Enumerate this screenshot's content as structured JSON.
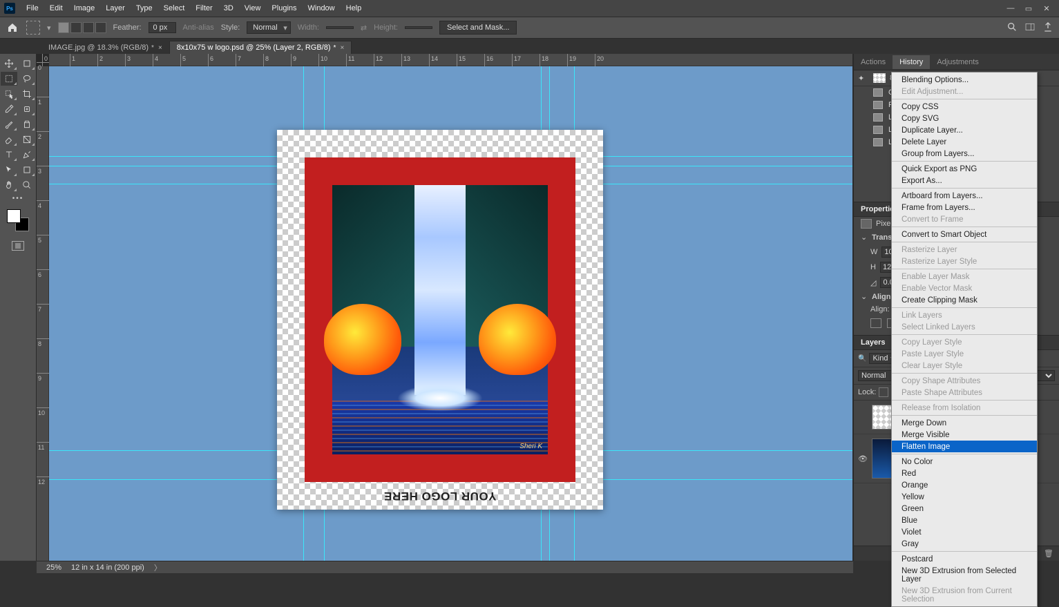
{
  "menubar": [
    "File",
    "Edit",
    "Image",
    "Layer",
    "Type",
    "Select",
    "Filter",
    "3D",
    "View",
    "Plugins",
    "Window",
    "Help"
  ],
  "optionsbar": {
    "feather_label": "Feather:",
    "feather_value": "0 px",
    "antialias": "Anti-alias",
    "style_label": "Style:",
    "style_value": "Normal",
    "width_label": "Width:",
    "height_label": "Height:",
    "select_mask": "Select and Mask..."
  },
  "tabs": [
    {
      "label": "IMAGE.jpg @ 18.3% (RGB/8)",
      "dirty": "*",
      "active": false
    },
    {
      "label": "8x10x75 w logo.psd @ 25% (Layer 2, RGB/8)",
      "dirty": "*",
      "active": true
    }
  ],
  "ruler_h": [
    "0",
    "1",
    "2",
    "3",
    "4",
    "5",
    "6",
    "7",
    "8",
    "9",
    "10",
    "11",
    "12",
    "13",
    "14",
    "15",
    "16",
    "17",
    "18",
    "19",
    "20"
  ],
  "ruler_v": [
    "0",
    "1",
    "2",
    "3",
    "4",
    "5",
    "6",
    "7",
    "8",
    "9",
    "10",
    "11",
    "12"
  ],
  "canvas": {
    "logo_text": "YOUR LOGO HERE",
    "signature": "Sheri K"
  },
  "panel_tabs_top": [
    "Actions",
    "History",
    "Adjustments"
  ],
  "history": {
    "doc": "8x10x75 w logo.psd",
    "items": [
      "Open",
      "Paste",
      "Layer V",
      "Layer V",
      "Layer V"
    ]
  },
  "properties": {
    "title": "Properties",
    "type": "Pixel Layer",
    "transform_title": "Transform",
    "w_label": "W",
    "w_val": "10 in",
    "h_label": "H",
    "h_val": "12 in",
    "angle": "0.00°",
    "align_title": "Align and Dis",
    "align_label": "Align:"
  },
  "layers": {
    "title": "Layers",
    "kind": "Kind",
    "blend": "Normal",
    "lock": "Lock:"
  },
  "context_menu": [
    {
      "t": "Blending Options..."
    },
    {
      "t": "Edit Adjustment...",
      "d": true
    },
    {
      "sep": true
    },
    {
      "t": "Copy CSS"
    },
    {
      "t": "Copy SVG"
    },
    {
      "t": "Duplicate Layer..."
    },
    {
      "t": "Delete Layer"
    },
    {
      "t": "Group from Layers..."
    },
    {
      "sep": true
    },
    {
      "t": "Quick Export as PNG"
    },
    {
      "t": "Export As..."
    },
    {
      "sep": true
    },
    {
      "t": "Artboard from Layers..."
    },
    {
      "t": "Frame from Layers..."
    },
    {
      "t": "Convert to Frame",
      "d": true
    },
    {
      "sep": true
    },
    {
      "t": "Convert to Smart Object"
    },
    {
      "sep": true
    },
    {
      "t": "Rasterize Layer",
      "d": true
    },
    {
      "t": "Rasterize Layer Style",
      "d": true
    },
    {
      "sep": true
    },
    {
      "t": "Enable Layer Mask",
      "d": true
    },
    {
      "t": "Enable Vector Mask",
      "d": true
    },
    {
      "t": "Create Clipping Mask"
    },
    {
      "sep": true
    },
    {
      "t": "Link Layers",
      "d": true
    },
    {
      "t": "Select Linked Layers",
      "d": true
    },
    {
      "sep": true
    },
    {
      "t": "Copy Layer Style",
      "d": true
    },
    {
      "t": "Paste Layer Style",
      "d": true
    },
    {
      "t": "Clear Layer Style",
      "d": true
    },
    {
      "sep": true
    },
    {
      "t": "Copy Shape Attributes",
      "d": true
    },
    {
      "t": "Paste Shape Attributes",
      "d": true
    },
    {
      "sep": true
    },
    {
      "t": "Release from Isolation",
      "d": true
    },
    {
      "sep": true
    },
    {
      "t": "Merge Down"
    },
    {
      "t": "Merge Visible"
    },
    {
      "t": "Flatten Image",
      "hl": true
    },
    {
      "sep": true
    },
    {
      "t": "No Color"
    },
    {
      "t": "Red"
    },
    {
      "t": "Orange"
    },
    {
      "t": "Yellow"
    },
    {
      "t": "Green"
    },
    {
      "t": "Blue"
    },
    {
      "t": "Violet"
    },
    {
      "t": "Gray"
    },
    {
      "sep": true
    },
    {
      "t": "Postcard"
    },
    {
      "t": "New 3D Extrusion from Selected Layer"
    },
    {
      "t": "New 3D Extrusion from Current Selection",
      "d": true
    }
  ],
  "statusbar": {
    "zoom": "25%",
    "docinfo": "12 in x 14 in (200 ppi)"
  }
}
